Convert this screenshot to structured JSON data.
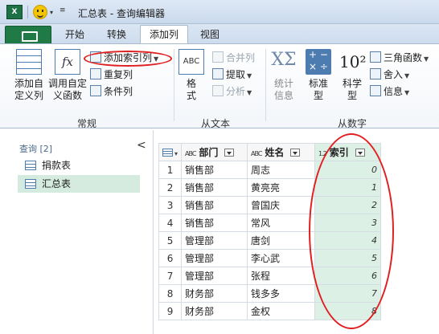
{
  "window": {
    "app_icon_text": "X",
    "title": "汇总表 - 查询编辑器"
  },
  "tabs": [
    {
      "label": "开始"
    },
    {
      "label": "转换"
    },
    {
      "label": "添加列"
    },
    {
      "label": "视图"
    }
  ],
  "active_tab": "添加列",
  "ribbon": {
    "general": {
      "label": "常规",
      "custom_column": "添加自\n定义列",
      "invoke_function": "调用自定\n义函数",
      "index_column": "添加索引列",
      "duplicate_column": "重复列",
      "conditional_column": "条件列"
    },
    "from_text": {
      "label": "从文本",
      "format": "格\n式",
      "merge_columns": "合并列",
      "extract": "提取",
      "parse": "分析"
    },
    "from_number": {
      "label": "从数字",
      "statistics": "统计\n信息",
      "standard": "标准\n型",
      "scientific": "科学\n型",
      "trigonometry": "三角函数",
      "rounding": "舍入",
      "information": "信息"
    }
  },
  "queries": {
    "header": "查询 [2]",
    "collapse_glyph": "<",
    "items": [
      {
        "label": "捐款表",
        "selected": false
      },
      {
        "label": "汇总表",
        "selected": true
      }
    ]
  },
  "table": {
    "columns": [
      {
        "type": "ABC",
        "name": "部门"
      },
      {
        "type": "ABC",
        "name": "姓名"
      },
      {
        "type": "1.2",
        "name": "索引"
      }
    ],
    "rows": [
      {
        "n": "1",
        "dept": "销售部",
        "name": "周志",
        "idx": "0"
      },
      {
        "n": "2",
        "dept": "销售部",
        "name": "黄亮亮",
        "idx": "1"
      },
      {
        "n": "3",
        "dept": "销售部",
        "name": "曾国庆",
        "idx": "2"
      },
      {
        "n": "4",
        "dept": "销售部",
        "name": "常风",
        "idx": "3"
      },
      {
        "n": "5",
        "dept": "管理部",
        "name": "唐剑",
        "idx": "4"
      },
      {
        "n": "6",
        "dept": "管理部",
        "name": "李心武",
        "idx": "5"
      },
      {
        "n": "7",
        "dept": "管理部",
        "name": "张程",
        "idx": "6"
      },
      {
        "n": "8",
        "dept": "财务部",
        "name": "钱多多",
        "idx": "7"
      },
      {
        "n": "9",
        "dept": "财务部",
        "name": "金权",
        "idx": "8"
      }
    ]
  },
  "colors": {
    "accent_green": "#1f7a46",
    "highlight_red": "#e02020",
    "index_column_fill": "#ddf0e5"
  }
}
